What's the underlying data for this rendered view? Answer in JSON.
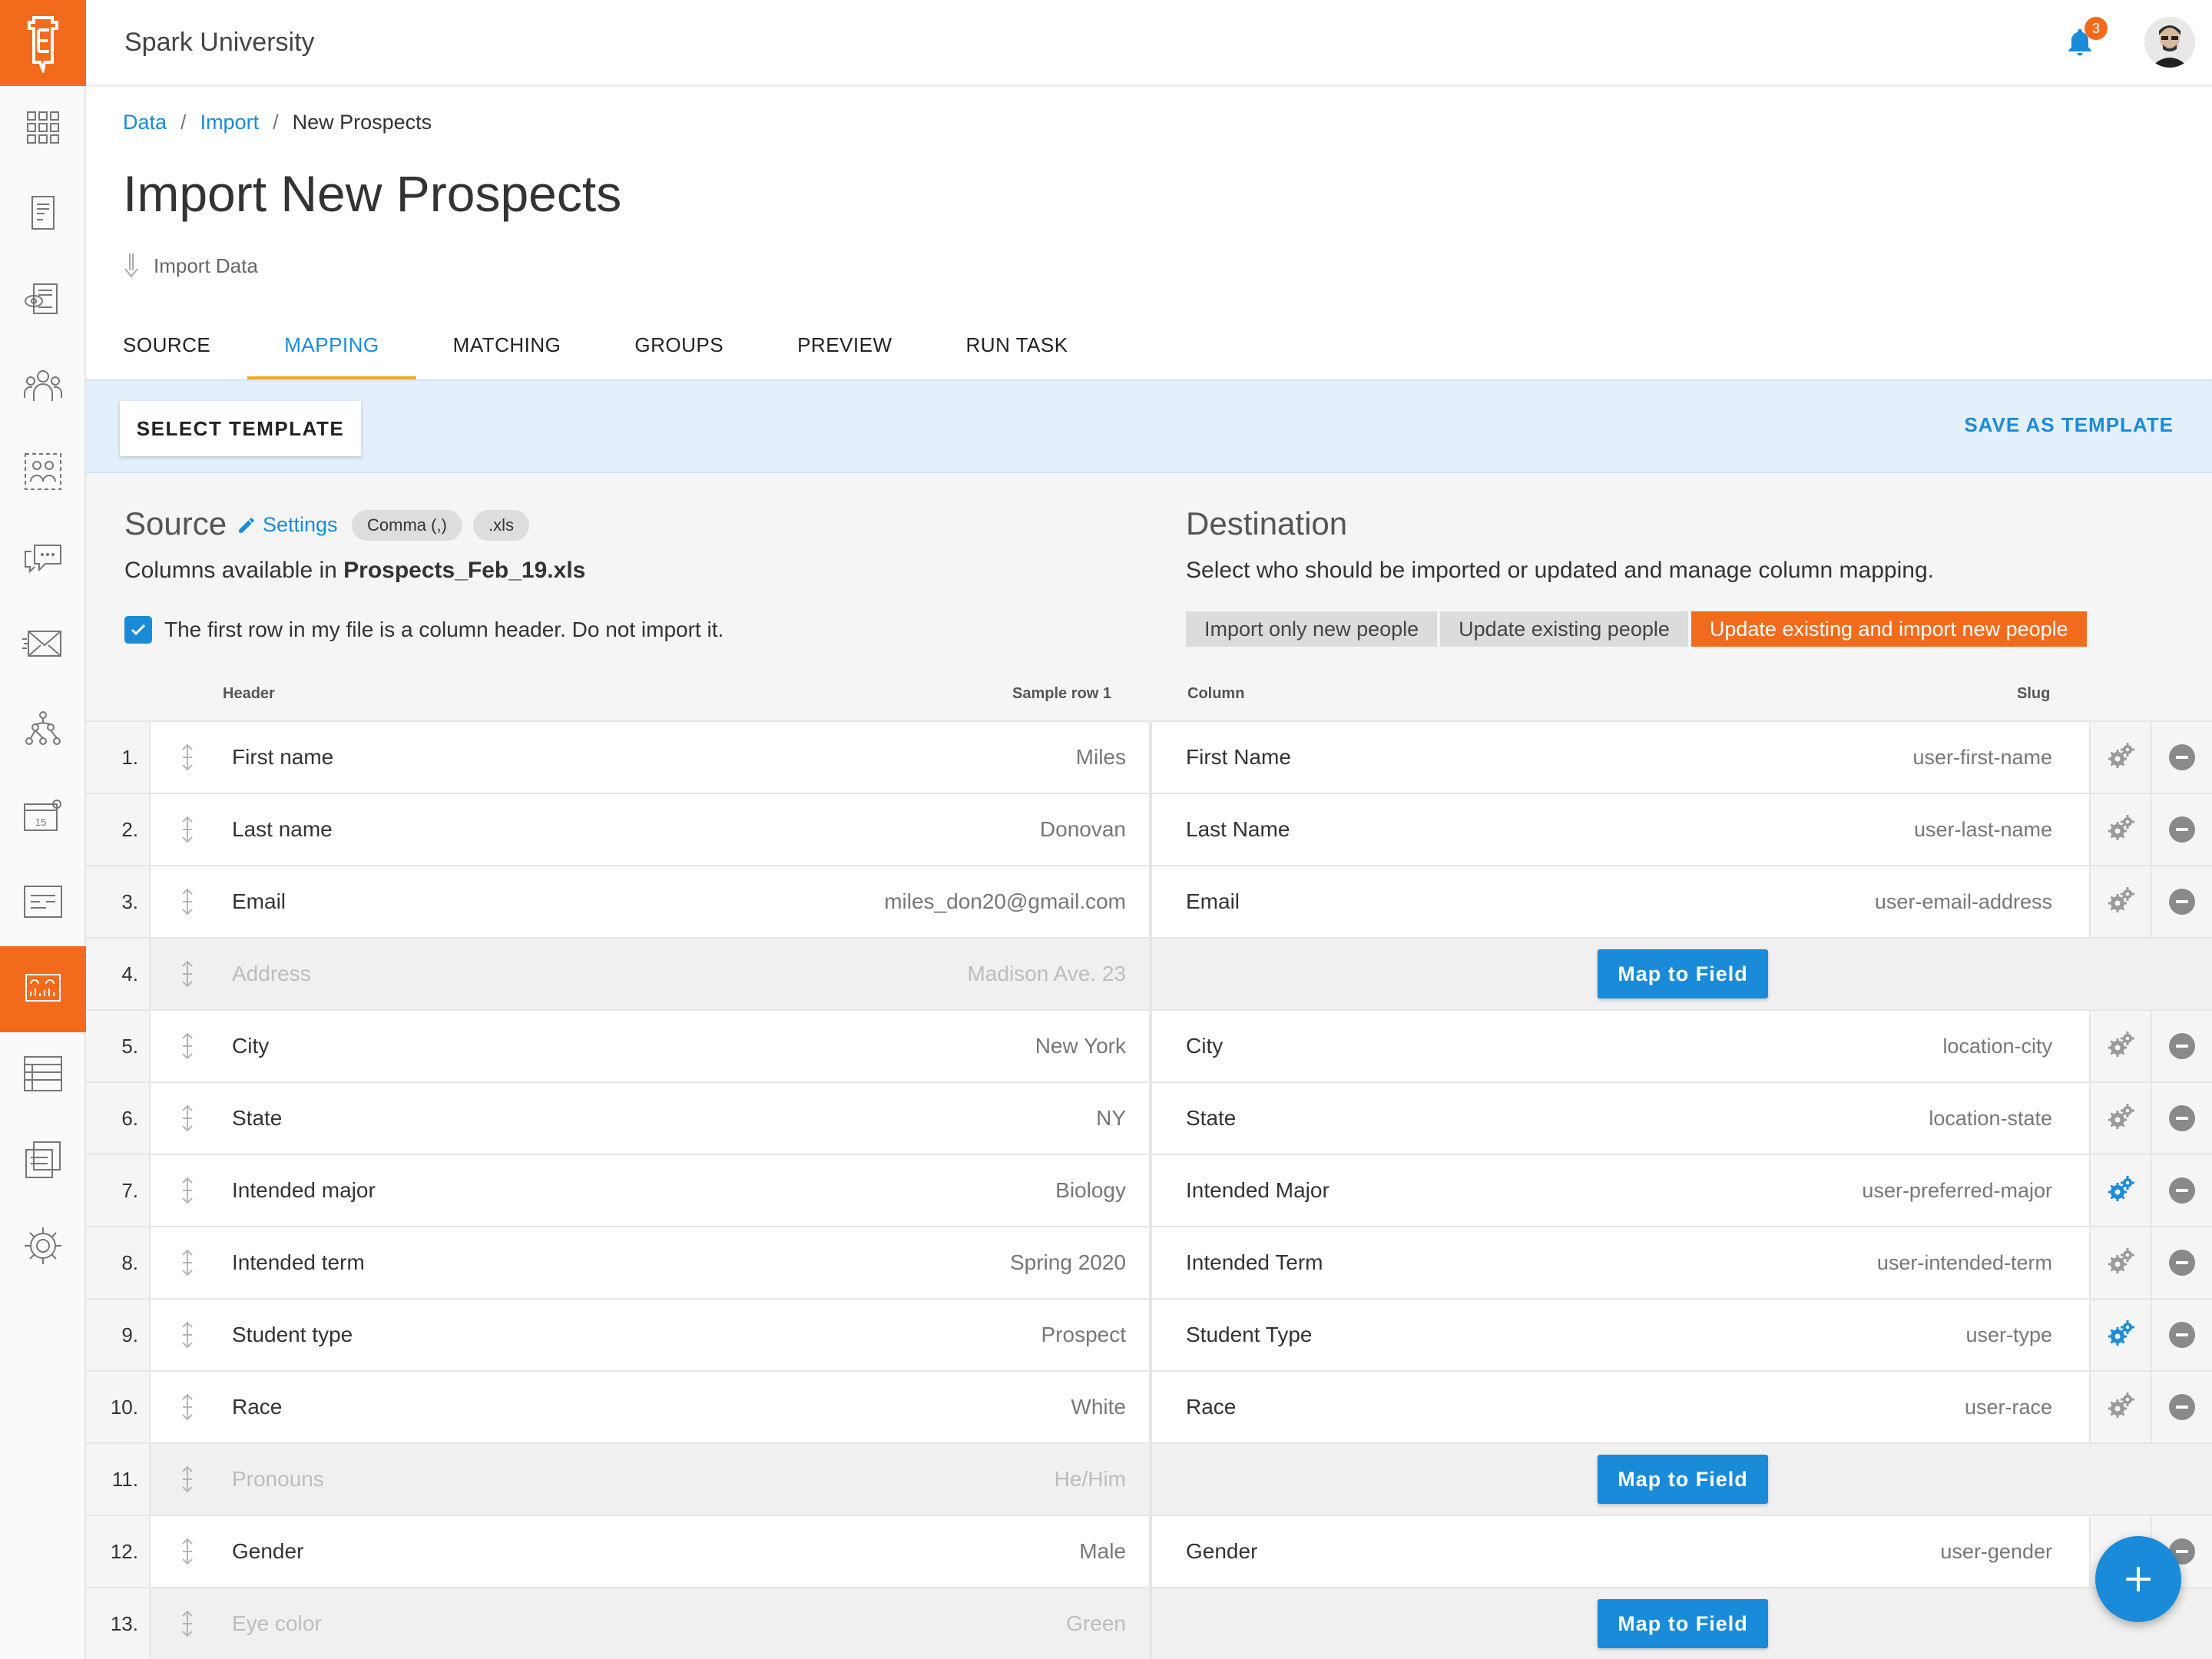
{
  "app": {
    "org_name": "Spark University",
    "notification_count": "3",
    "accent": "#f26b1d",
    "link": "#1a8bd8"
  },
  "sidebar": {
    "items": [
      {
        "icon": "grid-icon"
      },
      {
        "icon": "document-icon"
      },
      {
        "icon": "review-icon"
      },
      {
        "icon": "people-icon"
      },
      {
        "icon": "groups-icon"
      },
      {
        "icon": "chat-icon"
      },
      {
        "icon": "mail-icon"
      },
      {
        "icon": "workflow-icon"
      },
      {
        "icon": "calendar-icon",
        "text": "15"
      },
      {
        "icon": "forms-icon"
      },
      {
        "icon": "data-icon",
        "active": true
      },
      {
        "icon": "table-icon"
      },
      {
        "icon": "files-icon"
      },
      {
        "icon": "settings-icon"
      }
    ]
  },
  "breadcrumb": {
    "data": "Data",
    "import": "Import",
    "current": "New Prospects"
  },
  "page": {
    "title": "Import New Prospects",
    "subtitle": "Import Data"
  },
  "tabs": [
    "SOURCE",
    "MAPPING",
    "MATCHING",
    "GROUPS",
    "PREVIEW",
    "RUN TASK"
  ],
  "toolbar": {
    "select_template": "SELECT TEMPLATE",
    "save_template": "SAVE AS TEMPLATE"
  },
  "source": {
    "title": "Source",
    "settings": "Settings",
    "chip_delimiter": "Comma (,)",
    "chip_ext": ".xls",
    "desc_prefix": "Columns available in ",
    "filename": "Prospects_Feb_19.xls",
    "checkbox_label": "The first row in my file is a column header. Do not import it."
  },
  "destination": {
    "title": "Destination",
    "desc": "Select who should be imported or updated and manage column mapping.",
    "modes": [
      "Import only new people",
      "Update existing people",
      "Update existing and import new people"
    ]
  },
  "table": {
    "headers": {
      "header": "Header",
      "sample": "Sample row 1",
      "column": "Column",
      "slug": "Slug"
    },
    "map_label": "Map to Field",
    "rows": [
      {
        "num": "1.",
        "header": "First name",
        "sample": "Miles",
        "column": "First Name",
        "slug": "user-first-name",
        "mapped": true,
        "gear": "gray"
      },
      {
        "num": "2.",
        "header": "Last name",
        "sample": "Donovan",
        "column": "Last Name",
        "slug": "user-last-name",
        "mapped": true,
        "gear": "gray"
      },
      {
        "num": "3.",
        "header": "Email",
        "sample": "miles_don20@gmail.com",
        "column": "Email",
        "slug": "user-email-address",
        "mapped": true,
        "gear": "gray"
      },
      {
        "num": "4.",
        "header": "Address",
        "sample": "Madison Ave. 23",
        "mapped": false
      },
      {
        "num": "5.",
        "header": "City",
        "sample": "New York",
        "column": "City",
        "slug": "location-city",
        "mapped": true,
        "gear": "gray"
      },
      {
        "num": "6.",
        "header": "State",
        "sample": "NY",
        "column": "State",
        "slug": "location-state",
        "mapped": true,
        "gear": "gray"
      },
      {
        "num": "7.",
        "header": "Intended major",
        "sample": "Biology",
        "column": "Intended Major",
        "slug": "user-preferred-major",
        "mapped": true,
        "gear": "blue"
      },
      {
        "num": "8.",
        "header": "Intended term",
        "sample": "Spring 2020",
        "column": "Intended Term",
        "slug": "user-intended-term",
        "mapped": true,
        "gear": "gray"
      },
      {
        "num": "9.",
        "header": "Student type",
        "sample": "Prospect",
        "column": "Student Type",
        "slug": "user-type",
        "mapped": true,
        "gear": "blue"
      },
      {
        "num": "10.",
        "header": "Race",
        "sample": "White",
        "column": "Race",
        "slug": "user-race",
        "mapped": true,
        "gear": "gray"
      },
      {
        "num": "11.",
        "header": "Pronouns",
        "sample": "He/Him",
        "mapped": false
      },
      {
        "num": "12.",
        "header": "Gender",
        "sample": "Male",
        "column": "Gender",
        "slug": "user-gender",
        "mapped": true,
        "gear": "none"
      },
      {
        "num": "13.",
        "header": "Eye color",
        "sample": "Green",
        "mapped": false
      }
    ]
  }
}
